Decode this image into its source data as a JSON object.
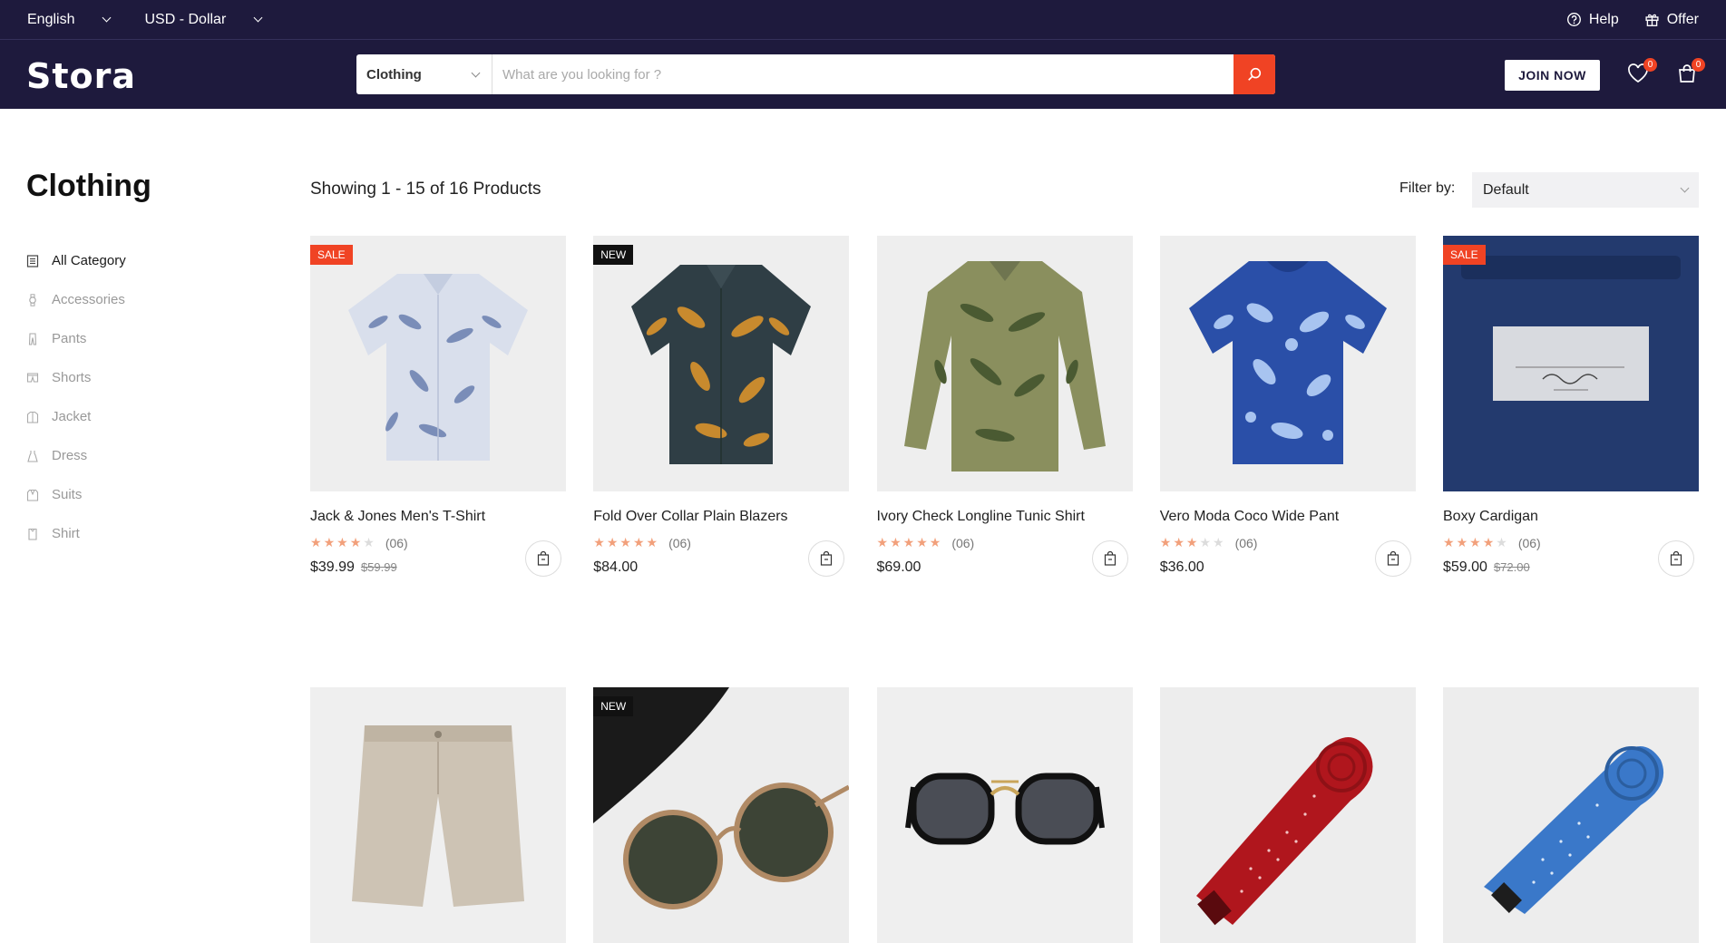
{
  "topbar": {
    "language": "English",
    "currency": "USD - Dollar",
    "help": "Help",
    "offer": "Offer"
  },
  "header": {
    "logo": "Stora",
    "search_category": "Clothing",
    "search_placeholder": "What are you looking for ?",
    "join_label": "JOIN NOW",
    "wishlist_count": "0",
    "cart_count": "0"
  },
  "sidebar": {
    "title": "Clothing",
    "categories": [
      {
        "label": "All Category",
        "icon": "list-icon"
      },
      {
        "label": "Accessories",
        "icon": "watch-icon"
      },
      {
        "label": "Pants",
        "icon": "pants-icon"
      },
      {
        "label": "Shorts",
        "icon": "shorts-icon"
      },
      {
        "label": "Jacket",
        "icon": "jacket-icon"
      },
      {
        "label": "Dress",
        "icon": "dress-icon"
      },
      {
        "label": "Suits",
        "icon": "suit-icon"
      },
      {
        "label": "Shirt",
        "icon": "shirt-icon"
      }
    ]
  },
  "main": {
    "showing": "Showing 1 - 15 of 16 Products",
    "filter_label": "Filter by:",
    "filter_value": "Default"
  },
  "products": [
    {
      "name": "Jack & Jones Men's T-Shirt",
      "tag": "SALE",
      "rating": 4,
      "reviews": "(06)",
      "price": "$39.99",
      "old_price": "$59.99",
      "image": "floral-shirt"
    },
    {
      "name": "Fold Over Collar Plain Blazers",
      "tag": "NEW",
      "rating": 5,
      "reviews": "(06)",
      "price": "$84.00",
      "old_price": "",
      "image": "leaf-shirt"
    },
    {
      "name": "Ivory Check Longline Tunic Shirt",
      "tag": "",
      "rating": 5,
      "reviews": "(06)",
      "price": "$69.00",
      "old_price": "",
      "image": "palm-shirt"
    },
    {
      "name": "Vero Moda Coco Wide Pant",
      "tag": "",
      "rating": 3,
      "reviews": "(06)",
      "price": "$36.00",
      "old_price": "",
      "image": "floral-tee"
    },
    {
      "name": "Boxy Cardigan",
      "tag": "SALE",
      "rating": 4,
      "reviews": "(06)",
      "price": "$59.00",
      "old_price": "$72.00",
      "image": "blazer-label"
    },
    {
      "name": "",
      "tag": "",
      "rating": 0,
      "reviews": "",
      "price": "",
      "old_price": "",
      "image": "shorts"
    },
    {
      "name": "",
      "tag": "NEW",
      "rating": 0,
      "reviews": "",
      "price": "",
      "old_price": "",
      "image": "sunglasses-round"
    },
    {
      "name": "",
      "tag": "",
      "rating": 0,
      "reviews": "",
      "price": "",
      "old_price": "",
      "image": "sunglasses-black"
    },
    {
      "name": "",
      "tag": "",
      "rating": 0,
      "reviews": "",
      "price": "",
      "old_price": "",
      "image": "red-tie"
    },
    {
      "name": "",
      "tag": "",
      "rating": 0,
      "reviews": "",
      "price": "",
      "old_price": "",
      "image": "blue-tie"
    }
  ],
  "colors": {
    "navy": "#1e1a3d",
    "accent": "#f04324",
    "star": "#f2a07b"
  }
}
